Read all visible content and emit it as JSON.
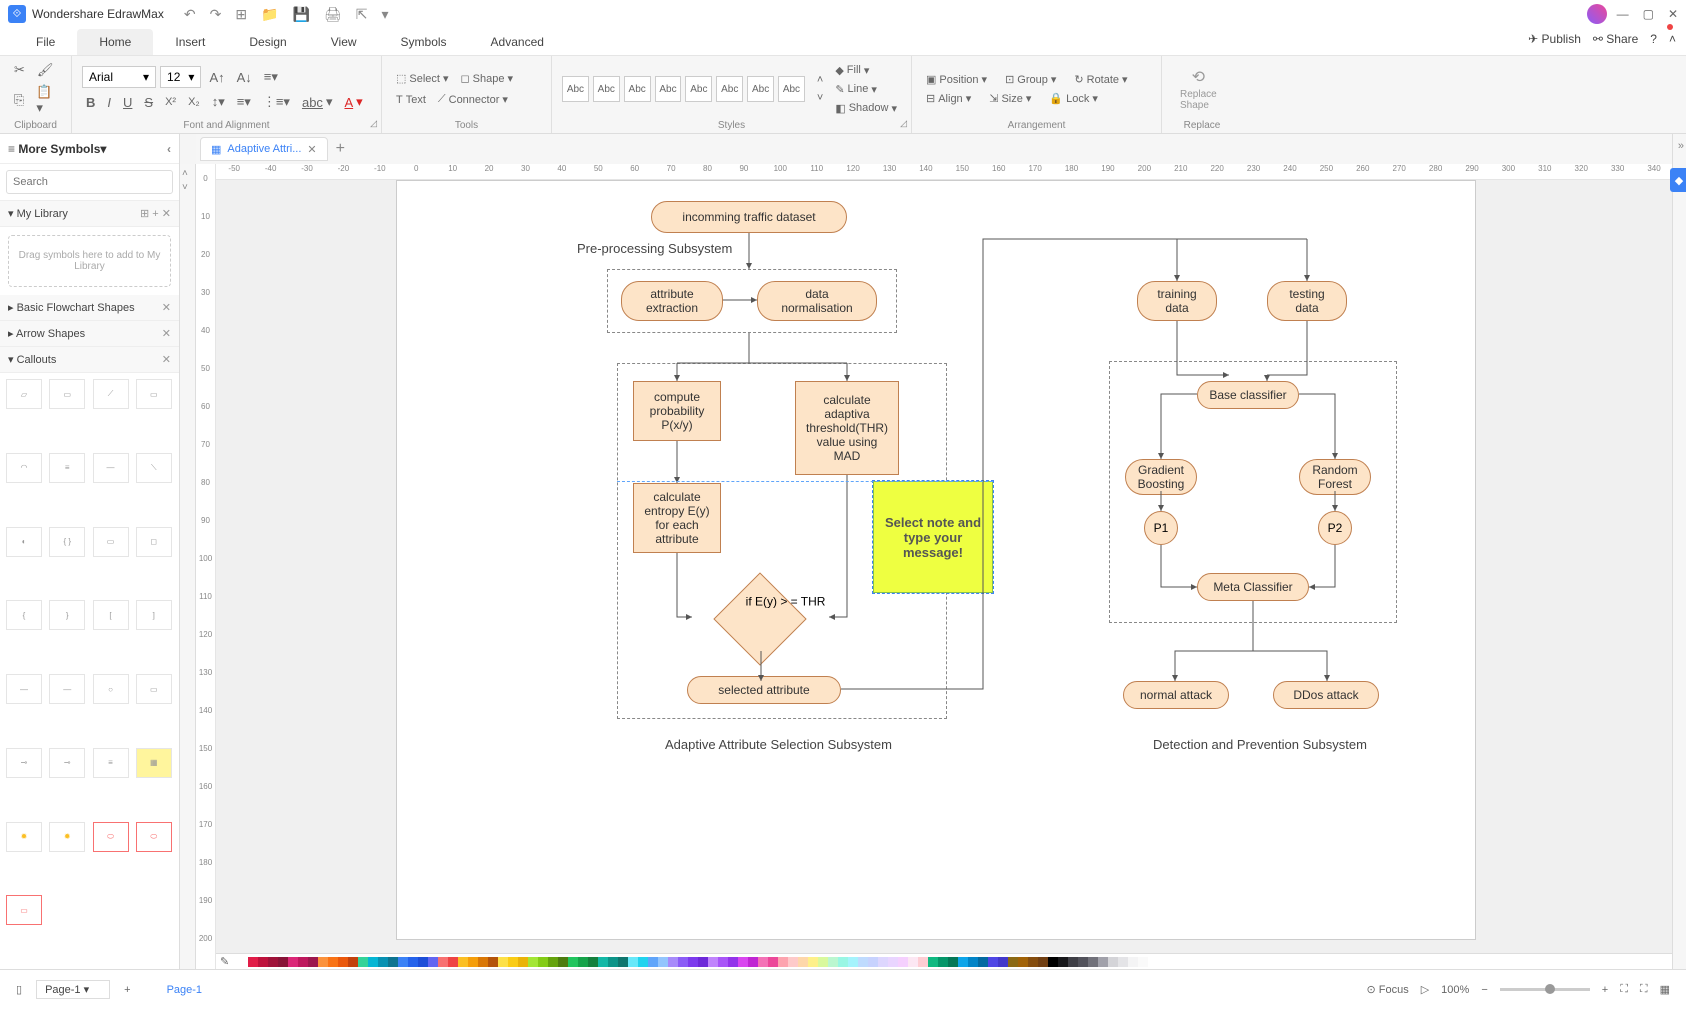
{
  "app": {
    "title": "Wondershare EdrawMax"
  },
  "menu": {
    "tabs": [
      "File",
      "Home",
      "Insert",
      "Design",
      "View",
      "Symbols",
      "Advanced"
    ],
    "active": "Home",
    "publish": "Publish",
    "share": "Share"
  },
  "ribbon": {
    "clipboard": "Clipboard",
    "font_align": "Font and Alignment",
    "tools": "Tools",
    "styles": "Styles",
    "arrangement": "Arrangement",
    "replace": "Replace",
    "font": "Arial",
    "size": "12",
    "select": "Select",
    "shape": "Shape",
    "text": "Text",
    "connector": "Connector",
    "abc": "Abc",
    "fill": "Fill",
    "line": "Line",
    "shadow": "Shadow",
    "position": "Position",
    "group": "Group",
    "rotate": "Rotate",
    "align": "Align",
    "sizeL": "Size",
    "lock": "Lock",
    "replace_shape": "Replace\nShape"
  },
  "left": {
    "more": "More Symbols",
    "search": "Search",
    "mylib": "My Library",
    "drop": "Drag symbols here to add to My Library",
    "sections": [
      "Basic Flowchart Shapes",
      "Arrow Shapes",
      "Callouts"
    ]
  },
  "doctab": "Adaptive Attri...",
  "hruler": [
    "-50",
    "-40",
    "-30",
    "-20",
    "-10",
    "0",
    "10",
    "20",
    "30",
    "40",
    "50",
    "60",
    "70",
    "80",
    "90",
    "100",
    "110",
    "120",
    "130",
    "140",
    "150",
    "160",
    "170",
    "180",
    "190",
    "200",
    "210",
    "220",
    "230",
    "240",
    "250",
    "260",
    "270",
    "280",
    "290",
    "300",
    "310",
    "320",
    "330",
    "340"
  ],
  "vruler": [
    "0",
    "10",
    "20",
    "30",
    "40",
    "50",
    "60",
    "70",
    "80",
    "90",
    "100",
    "110",
    "120",
    "130",
    "140",
    "150",
    "160",
    "170",
    "180",
    "190",
    "200"
  ],
  "flow": {
    "n1": "incomming traffic dataset",
    "pre": "Pre-processing Subsystem",
    "attr_ext": "attribute extraction",
    "data_norm": "data normalisation",
    "compute_p": "compute probability P(x/y)",
    "calc_thr": "calculate adaptiva threshold(THR) value using MAD",
    "calc_ent": "calculate entropy E(y) for each attribute",
    "cond": "if E(y) > = THR",
    "sel_attr": "selected attribute",
    "adapt_label": "Adaptive Attribute Selection Subsystem",
    "train": "training data",
    "test": "testing data",
    "base": "Base classifier",
    "gb": "Gradient Boosting",
    "rf": "Random Forest",
    "p1": "P1",
    "p2": "P2",
    "meta": "Meta Classifier",
    "normal": "normal attack",
    "ddos": "DDos attack",
    "det_label": "Detection and Prevention Subsystem",
    "note": "Select note and type your message!"
  },
  "status": {
    "page": "Page-1",
    "pagelink": "Page-1",
    "focus": "Focus",
    "zoom": "100%"
  },
  "colors": [
    "#ffffff",
    "#e11d48",
    "#be123c",
    "#9f1239",
    "#881337",
    "#db2777",
    "#be185d",
    "#9d174d",
    "#fb923c",
    "#f97316",
    "#ea580c",
    "#c2410c",
    "#34d399",
    "#06b6d4",
    "#0891b2",
    "#0e7490",
    "#3b82f6",
    "#2563eb",
    "#1d4ed8",
    "#6366f1",
    "#f87171",
    "#ef4444",
    "#fbbf24",
    "#f59e0b",
    "#d97706",
    "#b45309",
    "#fde047",
    "#facc15",
    "#eab308",
    "#a3e635",
    "#84cc16",
    "#65a30d",
    "#4d7c0f",
    "#22c55e",
    "#16a34a",
    "#15803d",
    "#14b8a6",
    "#0d9488",
    "#0f766e",
    "#67e8f9",
    "#22d3ee",
    "#60a5fa",
    "#93c5fd",
    "#a78bfa",
    "#8b5cf6",
    "#7c3aed",
    "#6d28d9",
    "#c084fc",
    "#a855f7",
    "#9333ea",
    "#d946ef",
    "#c026d3",
    "#f472b6",
    "#ec4899",
    "#fda4af",
    "#fecaca",
    "#fed7aa",
    "#fef08a",
    "#d9f99d",
    "#bbf7d0",
    "#99f6e4",
    "#a5f3fc",
    "#bfdbfe",
    "#c7d2fe",
    "#ddd6fe",
    "#e9d5ff",
    "#f5d0fe",
    "#fce7f3",
    "#fecdd3",
    "#10b981",
    "#059669",
    "#047857",
    "#0ea5e9",
    "#0284c7",
    "#0369a1",
    "#4f46e5",
    "#4338ca",
    "#8b6914",
    "#a16207",
    "#854d0e",
    "#713f12",
    "#000000",
    "#18181b",
    "#3f3f46",
    "#52525b",
    "#71717a",
    "#a1a1aa",
    "#d4d4d8",
    "#e4e4e7",
    "#f4f4f5",
    "#fafafa"
  ]
}
